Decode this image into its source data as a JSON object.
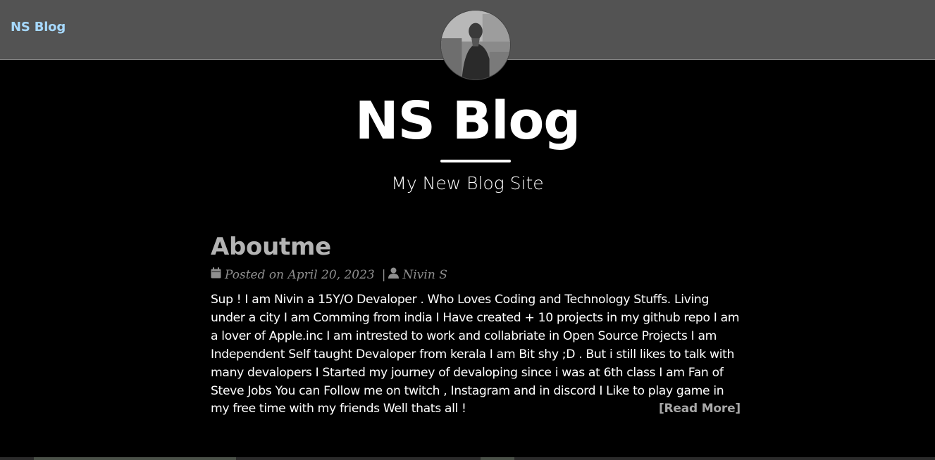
{
  "navbar": {
    "brand": "NS Blog"
  },
  "header": {
    "title": "NS Blog",
    "subtitle": "My New Blog Site"
  },
  "post": {
    "title": "Aboutme",
    "date_text": "Posted on April 20, 2023",
    "separator": "|",
    "author": "Nivin S",
    "body": "Sup ! I am Nivin a 15Y/O Devaloper . Who Loves Coding and Technology Stuffs. Living under a city I am Comming from india I Have created + 10 projects in my github repo I am a lover of Apple.inc I am intrested to work and collabriate in Open Source Projects I am Independent Self taught Devaloper from kerala I am Bit shy ;D . But i still likes to talk with many devalopers I Started my journey of devaloping since i was at 6th class I am Fan of Steve Jobs You can Follow me on twitch , Instagram and in discord I Like to play game in my free time with my friends Well thats all !",
    "read_more": "[Read More]"
  },
  "icons": {
    "date": "calendar-icon",
    "author": "user-icon"
  },
  "colors": {
    "navbar_bg": "#535353",
    "brand": "#a6d9ff",
    "page_bg": "#000000",
    "post_title": "#b3b3b3",
    "meta": "#8f8f8f"
  }
}
